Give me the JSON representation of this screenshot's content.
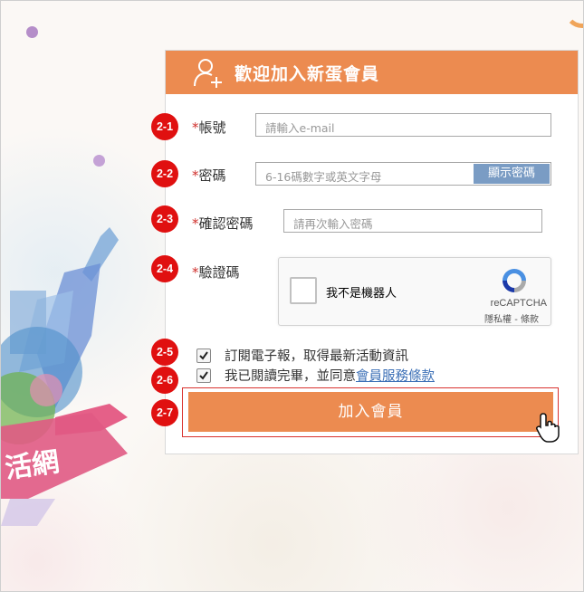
{
  "form": {
    "title": "歡迎加入新蛋會員",
    "account": {
      "label": "帳號",
      "placeholder": "請輸入e-mail"
    },
    "password": {
      "label": "密碼",
      "placeholder": "6-16碼數字或英文字母",
      "show_button": "顯示密碼"
    },
    "confirm_password": {
      "label": "確認密碼",
      "placeholder": "請再次輸入密碼"
    },
    "captcha": {
      "label": "驗證碼",
      "checkbox_label": "我不是機器人",
      "brand": "reCAPTCHA",
      "links": "隱私權 - 條款"
    },
    "required_mark": "*",
    "subscribe": {
      "text": "訂閱電子報，取得最新活動資訊",
      "checked": true
    },
    "agree": {
      "text": "我已閱讀完畢，並同意",
      "link": "會員服務條款",
      "checked": true
    },
    "submit": "加入會員"
  },
  "badges": [
    "2-1",
    "2-2",
    "2-3",
    "2-4",
    "2-5",
    "2-6",
    "2-7"
  ],
  "background": {
    "banner_text": "活網"
  },
  "colors": {
    "accent": "#ec8b50",
    "badge": "#e01010",
    "required": "#d0312d",
    "show_button": "#7a9cc4",
    "link": "#3b6fb6"
  },
  "icons": [
    "user-plus-icon",
    "recaptcha-logo-icon",
    "hand-cursor-icon",
    "checkbox-checked-icon"
  ]
}
